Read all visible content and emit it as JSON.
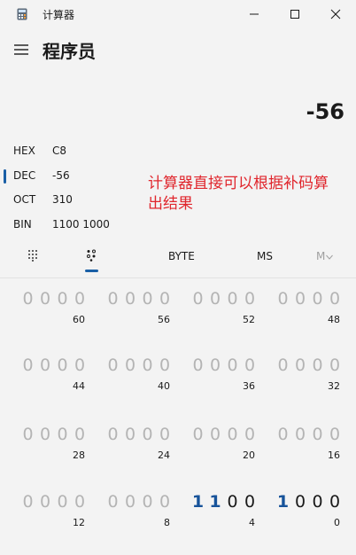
{
  "window": {
    "title": "计算器"
  },
  "header": {
    "mode": "程序员"
  },
  "display": {
    "value": "-56"
  },
  "radix": [
    {
      "label": "HEX",
      "value": "C8",
      "selected": false
    },
    {
      "label": "DEC",
      "value": "-56",
      "selected": true
    },
    {
      "label": "OCT",
      "value": "310",
      "selected": false
    },
    {
      "label": "BIN",
      "value": "1100 1000",
      "selected": false
    }
  ],
  "annotation": {
    "text": "计算器直接可以根据补码算出结果"
  },
  "toolbar": {
    "word_size": "BYTE",
    "ms": "MS",
    "mv": "M"
  },
  "bitrows": [
    {
      "groups": [
        "0000",
        "0000",
        "0000",
        "0000"
      ],
      "positions": [
        "60",
        "56",
        "52",
        "48"
      ]
    },
    {
      "groups": [
        "0000",
        "0000",
        "0000",
        "0000"
      ],
      "positions": [
        "44",
        "40",
        "36",
        "32"
      ]
    },
    {
      "groups": [
        "0000",
        "0000",
        "0000",
        "0000"
      ],
      "positions": [
        "28",
        "24",
        "20",
        "16"
      ]
    },
    {
      "groups": [
        "0000",
        "0000",
        "1100",
        "1000"
      ],
      "positions": [
        "12",
        "8",
        "4",
        "0"
      ]
    }
  ],
  "active_bits_from": 8,
  "colors": {
    "accent": "#1a5fa6",
    "annotation": "#e0262d",
    "inactive_bit": "#b4b4b4"
  }
}
